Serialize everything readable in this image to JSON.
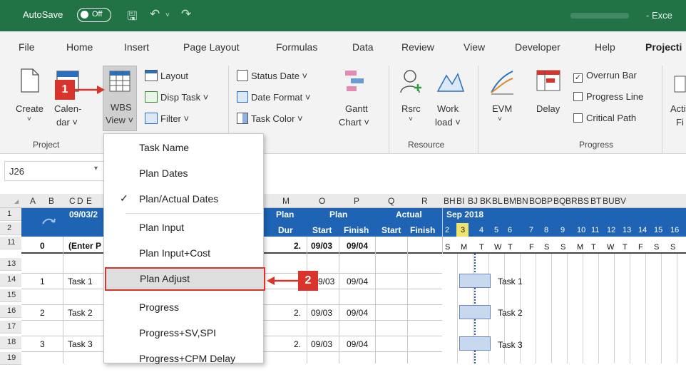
{
  "titlebar": {
    "autosave_label": "AutoSave",
    "autosave_state": "Off",
    "app_title": "- Exce"
  },
  "tabs": [
    "File",
    "Home",
    "Insert",
    "Page Layout",
    "Formulas",
    "Data",
    "Review",
    "View",
    "Developer",
    "Help",
    "Projecti"
  ],
  "ribbon": {
    "create": "Create",
    "calendar_line1": "Calen-",
    "calendar_line2": "dar ˅",
    "wbs_line1": "WBS",
    "wbs_line2": "View ˅",
    "layout": "Layout",
    "disp_task": "Disp Task ˅",
    "filter": "Filter ˅",
    "status_date": "Status Date ˅",
    "date_format": "Date Format ˅",
    "task_color": "Task Color ˅",
    "gantt_line1": "Gantt",
    "gantt_line2": "Chart ˅",
    "rsrc": "Rsrc",
    "work_line1": "Work",
    "work_line2": "load ˅",
    "evm": "EVM",
    "delay": "Delay",
    "overrun_bar": "Overrun Bar",
    "progress_line": "Progress Line",
    "critical_path": "Critical Path",
    "act_line1": "Acti",
    "act_line2": "Fi",
    "groups": {
      "project": "Project",
      "resource": "Resource",
      "progress": "Progress"
    }
  },
  "namebox": "J26",
  "columns": [
    "A",
    "B",
    "C",
    "D",
    "E",
    "M",
    "O",
    "P",
    "Q",
    "R",
    "BH",
    "BI",
    "BJ",
    "BK",
    "BL",
    "BM",
    "BN",
    "BO",
    "BP",
    "BQ",
    "BR",
    "BS",
    "BT",
    "BU",
    "BV"
  ],
  "rows": [
    "1",
    "2",
    "11",
    "13",
    "14",
    "15",
    "16",
    "17",
    "18",
    "19"
  ],
  "header": {
    "date_cell": "09/03/2",
    "plan_dur_1": "Plan",
    "plan_dur_2": "Dur",
    "plan": "Plan",
    "actual": "Actual",
    "start": "Start",
    "finish": "Finish",
    "actual_start": "Start",
    "actual_finish": "Finish",
    "month": "Sep 2018"
  },
  "days": [
    "2",
    "3",
    "4",
    "5",
    "6",
    "7",
    "8",
    "9",
    "10",
    "11",
    "12",
    "13",
    "14",
    "15",
    "16"
  ],
  "weekdays": [
    "S",
    "M",
    "T",
    "W",
    "T",
    "F",
    "S",
    "S",
    "M",
    "T",
    "W",
    "T",
    "F",
    "S",
    "S"
  ],
  "row11": {
    "a": "0",
    "name": "(Enter P",
    "dur": "2.",
    "start": "09/03",
    "finish": "09/04"
  },
  "tasks": [
    {
      "num": "1",
      "name": "Task 1",
      "dur": "",
      "start": "9/03",
      "finish": "09/04",
      "bar_label": "Task 1"
    },
    {
      "num": "2",
      "name": "Task 2",
      "dur": "2.",
      "start": "09/03",
      "finish": "09/04",
      "bar_label": "Task 2"
    },
    {
      "num": "3",
      "name": "Task 3",
      "dur": "2.",
      "start": "09/03",
      "finish": "09/04",
      "bar_label": "Task 3"
    }
  ],
  "menu": [
    "Task Name",
    "Plan Dates",
    "Plan/Actual Dates",
    "Plan Input",
    "Plan Input+Cost",
    "Plan Adjust",
    "Progress",
    "Progress+SV,SPI",
    "Progress+CPM Delay"
  ],
  "callouts": [
    "1",
    "2"
  ],
  "colors": {
    "excel_green": "#217346",
    "header_blue": "#1e63b4",
    "callout_red": "#d9342b"
  }
}
